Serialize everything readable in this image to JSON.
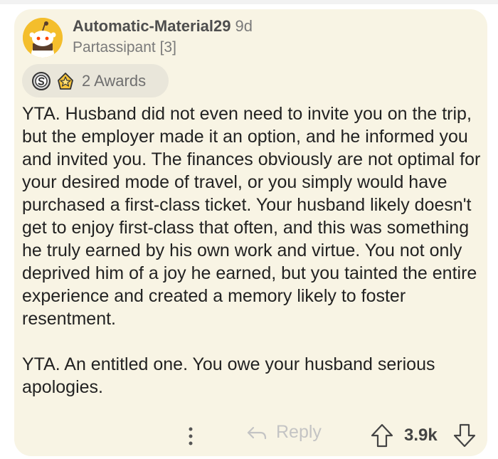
{
  "comment": {
    "author": "Automatic-Material29",
    "age": "9d",
    "flair": "Partassipant [3]",
    "avatar_icon": "snoo-avatar-icon",
    "awards": {
      "icons": [
        "silver-award-icon",
        "helpful-award-icon"
      ],
      "label": "2 Awards"
    },
    "paragraphs": [
      "YTA. Husband did not even need to invite you on the trip, but the employer made it an option, and he informed you and invited you. The finances obviously are not optimal for your desired mode of travel, or you simply would have purchased a first-class ticket. Your husband likely doesn't get to enjoy first-class that often, and this was something he truly earned by his own work and virtue. You not only deprived him of a joy he earned, but you tainted the entire experience and created a memory likely to foster resentment.",
      "YTA. An entitled one. You owe your husband serious apologies."
    ],
    "actions": {
      "more_icon": "more-vertical-icon",
      "reply_icon": "reply-arrow-icon",
      "reply_label": "Reply",
      "upvote_icon": "upvote-arrow-icon",
      "score": "3.9k",
      "downvote_icon": "downvote-arrow-icon"
    }
  },
  "colors": {
    "card_background": "#f8f4e4",
    "avatar": "#f4be2c",
    "award_pill": "#e9e6da"
  }
}
